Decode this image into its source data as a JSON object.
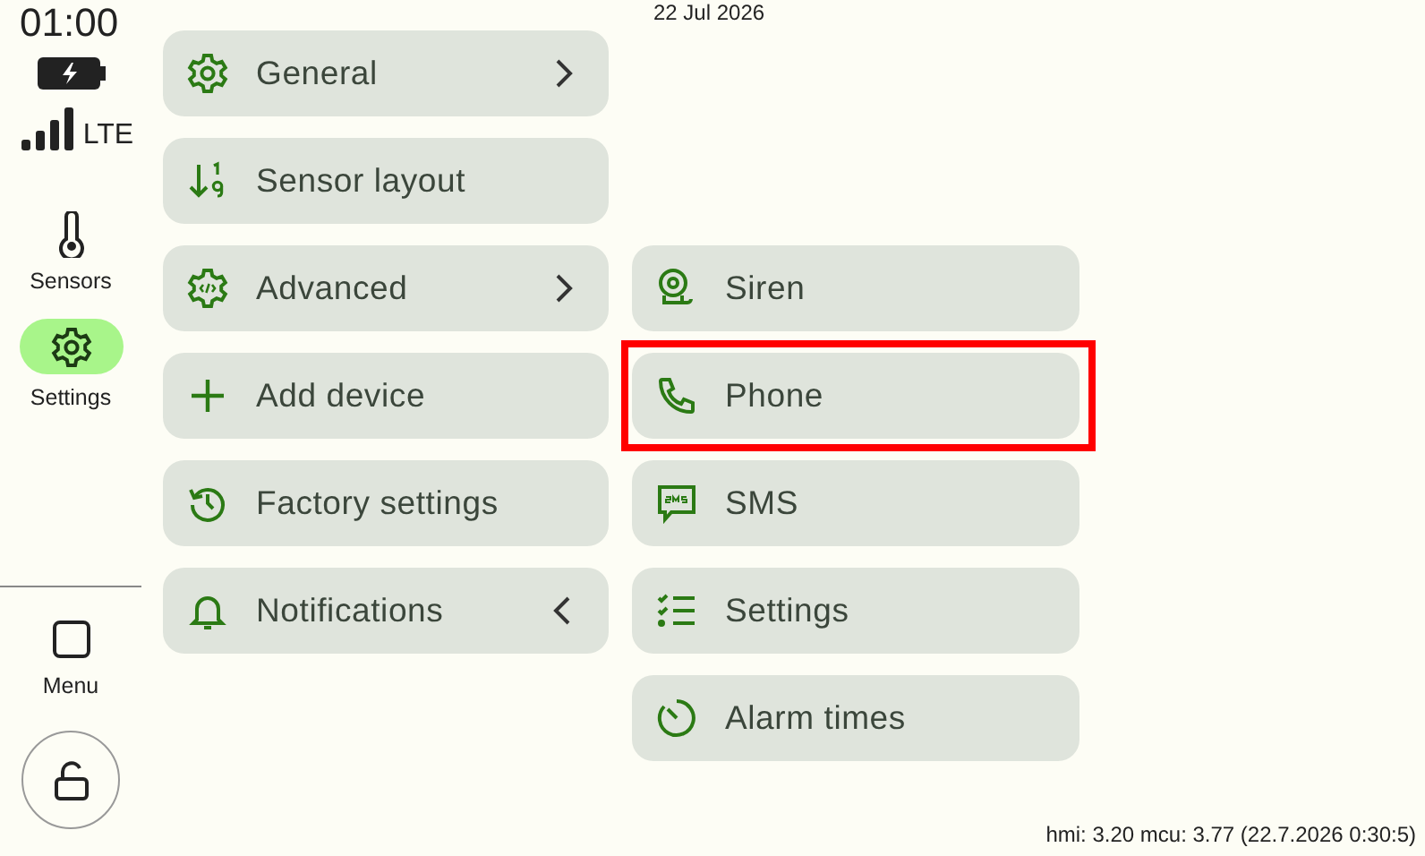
{
  "status": {
    "time": "01:00",
    "network": "LTE"
  },
  "nav": [
    {
      "label": "Sensors",
      "selected": false
    },
    {
      "label": "Settings",
      "selected": true
    },
    {
      "label": "Menu",
      "selected": false
    }
  ],
  "date": "22 Jul 2026",
  "menu_left": [
    {
      "label": "General",
      "kind": "submenu",
      "highlighted": false
    },
    {
      "label": "Sensor layout",
      "kind": "plain",
      "highlighted": false
    },
    {
      "label": "Advanced",
      "kind": "submenu",
      "highlighted": false
    },
    {
      "label": "Add device",
      "kind": "plain",
      "highlighted": false
    },
    {
      "label": "Factory settings",
      "kind": "plain",
      "highlighted": false
    },
    {
      "label": "Notifications",
      "kind": "open-submenu",
      "highlighted": false
    }
  ],
  "menu_right": [
    {
      "label": "Siren",
      "highlighted": false
    },
    {
      "label": "Phone",
      "highlighted": true
    },
    {
      "label": "SMS",
      "highlighted": false
    },
    {
      "label": "Settings",
      "highlighted": false
    },
    {
      "label": "Alarm times",
      "highlighted": false
    }
  ],
  "version": "hmi: 3.20 mcu: 3.77 (22.7.2026 0:30:5)"
}
